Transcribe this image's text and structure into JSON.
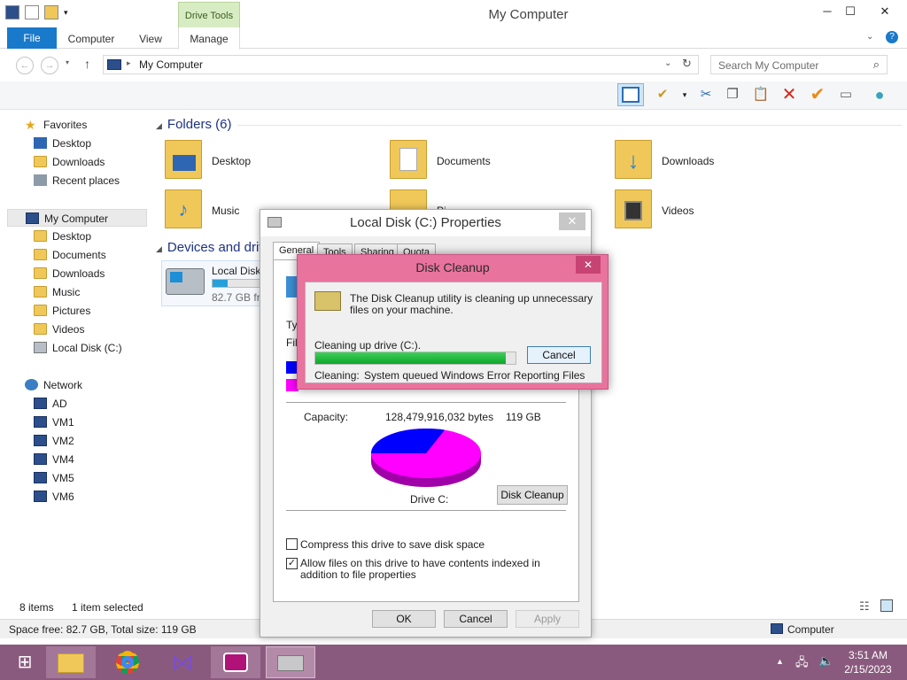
{
  "window": {
    "title": "My Computer",
    "contextual_tab": "Drive Tools"
  },
  "ribbon": {
    "tabs": [
      "File",
      "Computer",
      "View",
      "Manage"
    ]
  },
  "address": {
    "path": "My Computer",
    "search_placeholder": "Search My Computer"
  },
  "nav": {
    "favorites": {
      "label": "Favorites",
      "items": [
        "Desktop",
        "Downloads",
        "Recent places"
      ]
    },
    "computer": {
      "label": "My Computer",
      "items": [
        "Desktop",
        "Documents",
        "Downloads",
        "Music",
        "Pictures",
        "Videos",
        "Local Disk (C:)"
      ]
    },
    "network": {
      "label": "Network",
      "items": [
        "AD",
        "VM1",
        "VM2",
        "VM4",
        "VM5",
        "VM6"
      ]
    }
  },
  "content": {
    "folders_header": "Folders (6)",
    "folders": [
      "Desktop",
      "Documents",
      "Downloads",
      "Music",
      "Pi",
      "Videos"
    ],
    "devices_header": "Devices and driv",
    "drive": {
      "name": "Local Disk",
      "free_text": "82.7 GB fre",
      "used_fraction": 0.3
    }
  },
  "status": {
    "items": "8 items",
    "selected": "1 item selected",
    "space": "Space free: 82.7 GB, Total size: 119 GB",
    "zone": "Computer"
  },
  "properties": {
    "title": "Local Disk (C:) Properties",
    "tabs": [
      "General",
      "Tools",
      "Sharing",
      "Quota"
    ],
    "type_label": "Typ",
    "file_label": "File",
    "capacity_label": "Capacity:",
    "capacity_bytes": "128,479,916,032 bytes",
    "capacity_gb": "119 GB",
    "drive_label": "Drive C:",
    "cleanup_button": "Disk Cleanup",
    "compress_label": "Compress this drive to save disk space",
    "compress_checked": false,
    "index_label": "Allow files on this drive to have contents indexed in addition to file properties",
    "index_checked": true,
    "ok": "OK",
    "cancel": "Cancel",
    "apply": "Apply",
    "used_color": "#0000ff",
    "free_color": "#ff00ff"
  },
  "cleanup": {
    "title": "Disk Cleanup",
    "message": "The Disk Cleanup utility is cleaning up unnecessary files on your machine.",
    "drive_line": "Cleaning up drive  (C:).",
    "progress": 0.95,
    "cancel": "Cancel",
    "cleaning_label": "Cleaning:",
    "cleaning_item": "System queued Windows Error Reporting Files"
  },
  "taskbar": {
    "time": "3:51 AM",
    "date": "2/15/2023"
  }
}
